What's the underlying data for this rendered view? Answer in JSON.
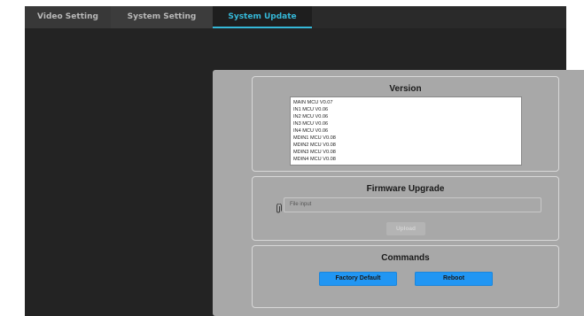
{
  "tabs": [
    {
      "label": "Video Setting"
    },
    {
      "label": "System Setting"
    },
    {
      "label": "System Update"
    }
  ],
  "active_tab": "System Update",
  "colors": {
    "accent": "#35b8d8",
    "button": "#2196f3"
  },
  "version": {
    "title": "Version",
    "lines": [
      "MAIN MCU V0.07",
      "IN1 MCU V0.06",
      "IN2 MCU V0.06",
      "IN3 MCU V0.06",
      "IN4 MCU V0.06",
      "MDIN1 MCU V0.08",
      "MDIN2 MCU V0.08",
      "MDIN3 MCU V0.08",
      "MDIN4 MCU V0.08"
    ]
  },
  "firmware": {
    "title": "Firmware Upgrade",
    "file_placeholder": "File input",
    "upload_label": "Upload",
    "icon": "paperclip-icon"
  },
  "commands": {
    "title": "Commands",
    "factory_default_label": "Factory Default",
    "reboot_label": "Reboot"
  }
}
